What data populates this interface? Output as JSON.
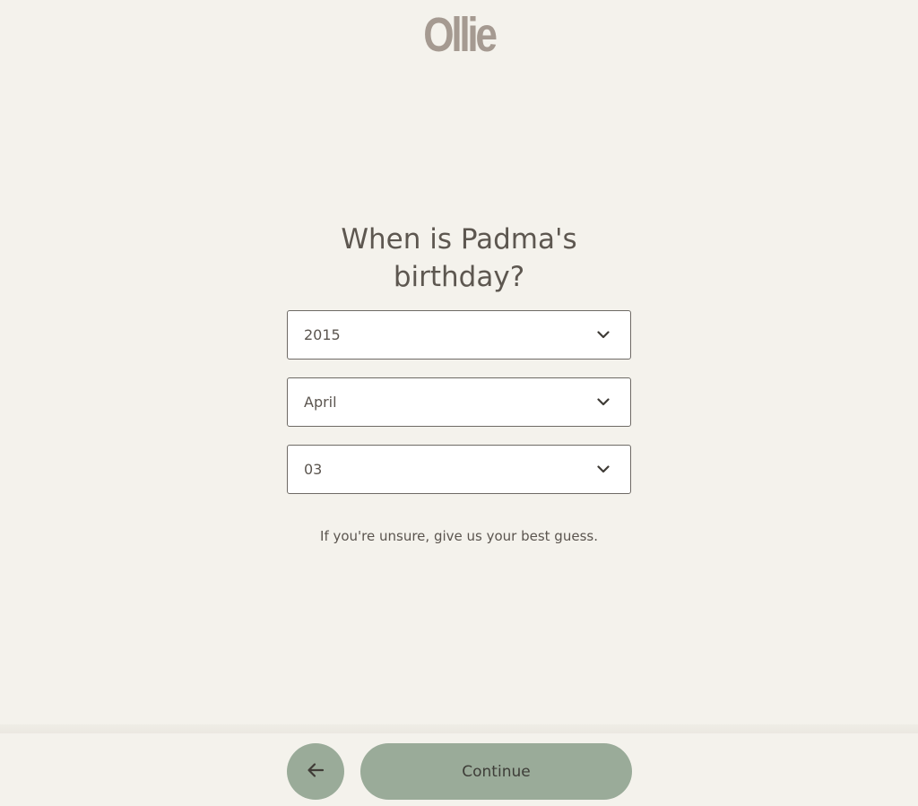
{
  "brand": {
    "logo_text": "Ollie",
    "logo_color": "#a59a91"
  },
  "question": {
    "line1": "When is Padma's",
    "line2": "birthday?"
  },
  "fields": {
    "year": {
      "value": "2015",
      "icon": "chevron-down-icon"
    },
    "month": {
      "value": "April",
      "icon": "chevron-down-icon"
    },
    "day": {
      "value": "03",
      "icon": "chevron-down-icon"
    }
  },
  "hint": "If you're unsure, give us your best guess.",
  "footer": {
    "back_icon": "arrow-left-icon",
    "continue_label": "Continue",
    "button_color": "#9aab99"
  }
}
